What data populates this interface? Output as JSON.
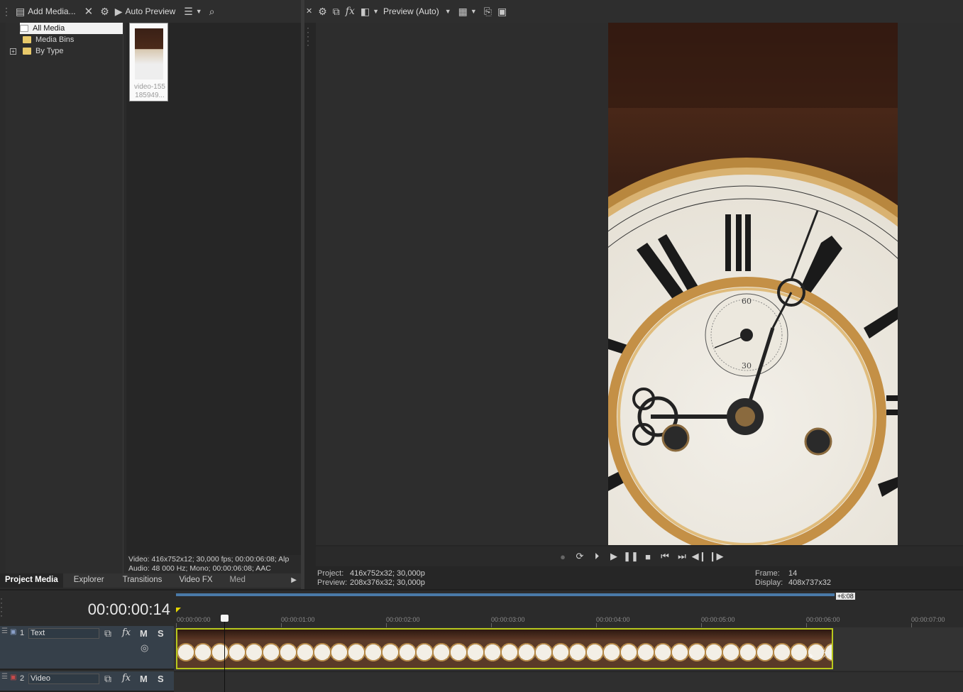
{
  "media_toolbar": {
    "add_media_label": "Add Media...",
    "auto_preview_label": "Auto Preview"
  },
  "media_tree": {
    "items": [
      {
        "label": "All Media",
        "selected": true
      },
      {
        "label": "Media Bins",
        "selected": false
      },
      {
        "label": "By Type",
        "selected": false,
        "expandable": true
      }
    ]
  },
  "media_file": {
    "label": "video-155 185949..."
  },
  "media_info": {
    "video_line": "Video: 416x752x12; 30,000 fps; 00:00:06:08; Alp",
    "audio_line": "Audio: 48 000 Hz; Mono; 00:00:06:08; AAC"
  },
  "left_tabs": [
    "Project Media",
    "Explorer",
    "Transitions",
    "Video FX",
    "Med"
  ],
  "preview_toolbar": {
    "preview_mode": "Preview (Auto)"
  },
  "preview_info": {
    "project_label": "Project:",
    "project_value": "416x752x32; 30,000p",
    "preview_label": "Preview:",
    "preview_value": "208x376x32; 30,000p",
    "frame_label": "Frame:",
    "frame_value": "14",
    "display_label": "Display:",
    "display_value": "408x737x32"
  },
  "timeline": {
    "timecode": "00:00:00:14",
    "end_marker": "+6:08",
    "ruler_labels": [
      "00:00:00:00",
      "00:00:01:00",
      "00:00:02:00",
      "00:00:03:00",
      "00:00:04:00",
      "00:00:05:00",
      "00:00:06:00",
      "00:00:07:00"
    ],
    "tracks": [
      {
        "number": "1",
        "name": "Text"
      },
      {
        "number": "2",
        "name": "Video"
      }
    ],
    "buttons": {
      "mute": "M",
      "solo": "S"
    }
  },
  "colors": {
    "clip_border": "#b8c81c",
    "loop_bar": "#4a7aa8",
    "selected_row": "#f2f2f2"
  }
}
